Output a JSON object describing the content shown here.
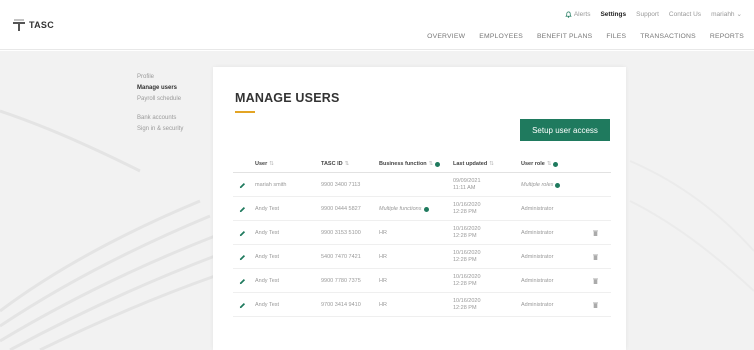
{
  "app": {
    "logo_text": "TASC"
  },
  "utility_nav": {
    "alerts": "Alerts",
    "settings": "Settings",
    "support": "Support",
    "contact": "Contact Us",
    "user_menu": "mariahh"
  },
  "main_nav": [
    "OVERVIEW",
    "EMPLOYEES",
    "BENEFIT PLANS",
    "FILES",
    "TRANSACTIONS",
    "REPORTS"
  ],
  "settings_nav": {
    "group1": [
      "Profile",
      "Manage users",
      "Payroll schedule"
    ],
    "group2": [
      "Bank accounts",
      "Sign in & security"
    ],
    "active": "Manage users"
  },
  "page": {
    "title": "MANAGE USERS",
    "setup_button": "Setup user access"
  },
  "table": {
    "headers": {
      "user": "User",
      "tasc_id": "TASC ID",
      "business_function": "Business function",
      "last_updated": "Last updated",
      "user_role": "User role"
    },
    "rows": [
      {
        "user": "mariah smith",
        "tasc_id": "9900 3400 7113",
        "business_function": "",
        "business_italic": false,
        "date": "09/09/2021",
        "time": "11:11 AM",
        "role": "Multiple roles",
        "role_italic": true,
        "role_info": true,
        "deletable": false
      },
      {
        "user": "Andy Test",
        "tasc_id": "9900 0444 5827",
        "business_function": "Multiple functions",
        "business_italic": true,
        "date": "10/16/2020",
        "time": "12:28 PM",
        "role": "Administrator",
        "role_italic": false,
        "role_info": false,
        "deletable": false
      },
      {
        "user": "Andy Test",
        "tasc_id": "9900 3153 5100",
        "business_function": "HR",
        "business_italic": false,
        "date": "10/16/2020",
        "time": "12:28 PM",
        "role": "Administrator",
        "role_italic": false,
        "role_info": false,
        "deletable": true
      },
      {
        "user": "Andy Test",
        "tasc_id": "5400 7470 7421",
        "business_function": "HR",
        "business_italic": false,
        "date": "10/16/2020",
        "time": "12:28 PM",
        "role": "Administrator",
        "role_italic": false,
        "role_info": false,
        "deletable": true
      },
      {
        "user": "Andy Test",
        "tasc_id": "9900 7780 7375",
        "business_function": "HR",
        "business_italic": false,
        "date": "10/16/2020",
        "time": "12:28 PM",
        "role": "Administrator",
        "role_italic": false,
        "role_info": false,
        "deletable": true
      },
      {
        "user": "Andy Test",
        "tasc_id": "9700 3414 9410",
        "business_function": "HR",
        "business_italic": false,
        "date": "10/16/2020",
        "time": "12:28 PM",
        "role": "Administrator",
        "role_italic": false,
        "role_info": false,
        "deletable": true
      }
    ]
  },
  "colors": {
    "brand_green": "#1f7a5e",
    "accent_gold": "#e3a424"
  },
  "icons": {
    "logo": "tasc-logo-icon",
    "alerts": "bell-icon",
    "user_menu": "chevron-down-icon",
    "edit": "pencil-icon",
    "delete": "trash-icon",
    "info": "info-icon",
    "sort": "sort-icon"
  }
}
